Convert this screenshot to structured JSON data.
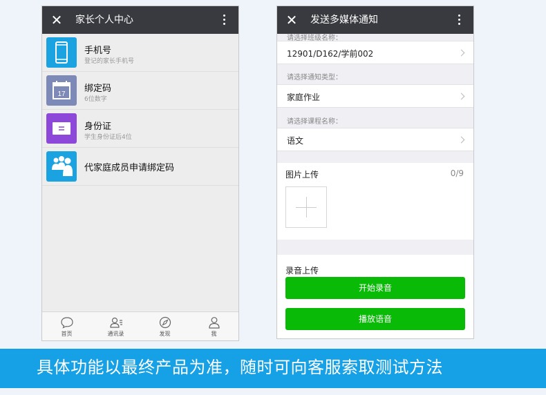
{
  "left_phone": {
    "title": "家长个人中心",
    "menu": [
      {
        "title": "手机号",
        "subtitle": "登记的家长手机号",
        "icon": "phone-icon",
        "color": "#1aa3e0"
      },
      {
        "title": "绑定码",
        "subtitle": "6位数字",
        "icon": "calendar-icon",
        "color": "#7d89b6",
        "icon_text": "17"
      },
      {
        "title": "身份证",
        "subtitle": "学生身份证后4位",
        "icon": "id-card-icon",
        "color": "#8d47d9"
      },
      {
        "title": "代家庭成员申请绑定码",
        "subtitle": "",
        "icon": "family-icon",
        "color": "#1aa3e0"
      }
    ],
    "tabs": [
      {
        "label": "首页",
        "icon": "chat-bubble-icon"
      },
      {
        "label": "通讯录",
        "icon": "contacts-icon"
      },
      {
        "label": "发现",
        "icon": "compass-icon"
      },
      {
        "label": "我",
        "icon": "person-icon"
      }
    ]
  },
  "right_phone": {
    "title": "发送多媒体通知",
    "class_label": "请选择班级名称：",
    "class_value": "12901/D162/学前002",
    "type_label": "请选择通知类型：",
    "type_value": "家庭作业",
    "course_label": "请选择课程名称：",
    "course_value": "语文",
    "image_upload_title": "图片上传",
    "image_upload_count": "0/9",
    "audio_upload_title": "录音上传",
    "start_record_label": "开始录音",
    "play_audio_label": "播放语音"
  },
  "banner": {
    "text": "具体功能以最终产品为准，随时可向客服索取测试方法"
  },
  "colors": {
    "topbar": "#393a3f",
    "green": "#09bb07",
    "banner": "#16a1e6"
  }
}
